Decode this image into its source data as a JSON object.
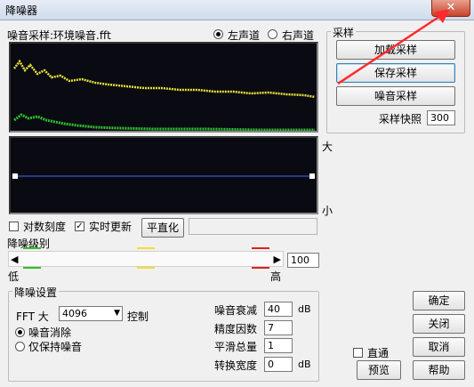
{
  "window": {
    "title": "降噪器",
    "close_glyph": "✕"
  },
  "top": {
    "sample_label": "噪音采样:环境噪音.fft",
    "channel_left": "左声道",
    "channel_right": "右声道",
    "label_large": "大",
    "label_small": "小"
  },
  "sampling": {
    "group_title": "采样",
    "load_button": "加载采样",
    "save_button": "保存采样",
    "noise_button": "噪音采样",
    "snapshot_label": "采样快照",
    "snapshot_value": "300"
  },
  "options": {
    "log_scale": "对数刻度",
    "realtime_update": "实时更新",
    "flatten_button": "平直化"
  },
  "level": {
    "title": "降噪级别",
    "low": "低",
    "high": "高",
    "value": "100",
    "left_arrow": "◀",
    "right_arrow": "▶"
  },
  "settings": {
    "group_title": "降噪设置",
    "fft_label": "FFT 大",
    "fft_value": "4096",
    "dropdown_arrow": "▼",
    "control_label": "控制",
    "noise_cancel": "噪音消除",
    "keep_noise": "仅保持噪音",
    "attenuation_label": "噪音衰减",
    "attenuation_value": "40",
    "attenuation_unit": "dB",
    "precision_label": "精度因数",
    "precision_value": "7",
    "smoothing_label": "平滑总量",
    "smoothing_value": "1",
    "transition_label": "转换宽度",
    "transition_value": "0",
    "transition_unit": "dB"
  },
  "right_buttons": {
    "ok": "确定",
    "close": "关闭",
    "cancel": "取消",
    "help": "帮助",
    "bypass": "直通",
    "preview": "预览"
  },
  "colors": {
    "spectrum_yellow": "#e8e23a",
    "spectrum_green": "#2fbf2f",
    "curve_blue": "#3a6cff",
    "marker_yellow": "#f0e030",
    "marker_red": "#e02020",
    "annotation_red": "#ff2a2a"
  }
}
